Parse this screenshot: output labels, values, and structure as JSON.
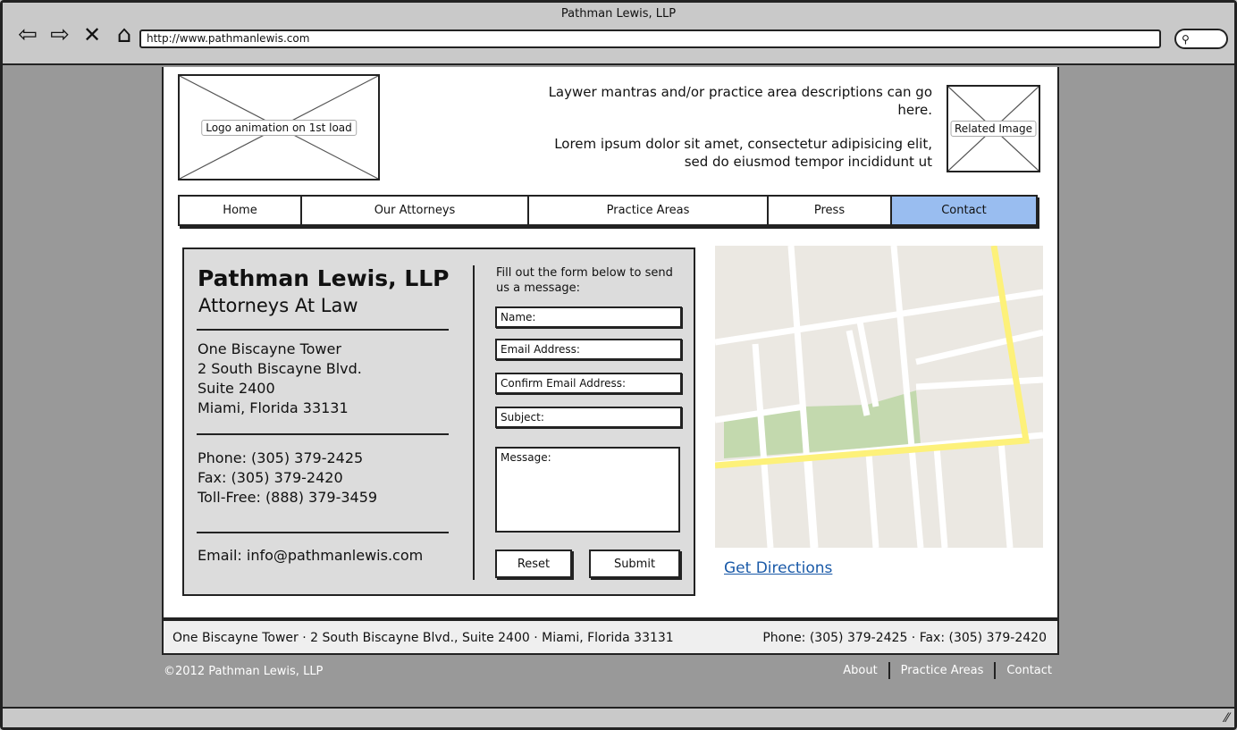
{
  "browser": {
    "title": "Pathman Lewis, LLP",
    "url": "http://www.pathmanlewis.com",
    "icons": [
      "back-arrow-icon",
      "forward-arrow-icon",
      "close-x-icon",
      "home-icon",
      "search-icon"
    ]
  },
  "header": {
    "logo_label": "Logo animation on 1st load",
    "mantra_line1": "Laywer mantras and/or practice area descriptions can go here.",
    "mantra_line2": "Lorem ipsum dolor sit amet, consectetur adipisicing elit, sed do eiusmod tempor incididunt ut",
    "related_image_label": "Related Image"
  },
  "nav": {
    "items": [
      {
        "label": "Home"
      },
      {
        "label": "Our Attorneys"
      },
      {
        "label": "Practice Areas"
      },
      {
        "label": "Press"
      },
      {
        "label": "Contact"
      }
    ],
    "active": "Contact",
    "active_color": "#99bdf0"
  },
  "contact": {
    "firm_name": "Pathman Lewis, LLP",
    "tagline": "Attorneys At Law",
    "address": [
      "One Biscayne Tower",
      "2 South Biscayne Blvd.",
      "Suite 2400",
      "Miami, Florida 33131"
    ],
    "phone": "Phone: (305) 379-2425",
    "fax": "Fax: (305) 379-2420",
    "tollfree": "Toll-Free: (888) 379-3459",
    "email": "Email: info@pathmanlewis.com"
  },
  "form": {
    "intro": "Fill out the form below to send us a message:",
    "name_placeholder": "Name:",
    "email_placeholder": "Email Address:",
    "confirm_email_placeholder": "Confirm Email Address:",
    "subject_placeholder": "Subject:",
    "message_placeholder": "Message:",
    "reset_label": "Reset",
    "submit_label": "Submit"
  },
  "map": {
    "directions_label": "Get Directions",
    "colors": {
      "land": "#ebe8e2",
      "road": "#ffffff",
      "highway": "#fdf17a",
      "park": "#c3d9ae"
    }
  },
  "footer": {
    "address_line": "One Biscayne Tower · 2 South Biscayne Blvd., Suite 2400 · Miami, Florida 33131",
    "phone_line": "Phone: (305) 379-2425 · Fax: (305) 379-2420",
    "copyright": "©2012 Pathman Lewis, LLP",
    "links": [
      {
        "label": "About"
      },
      {
        "label": "Practice Areas"
      },
      {
        "label": "Contact"
      }
    ]
  }
}
